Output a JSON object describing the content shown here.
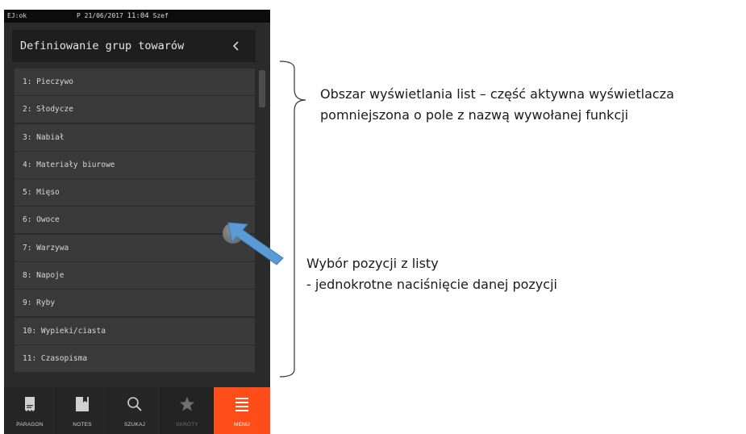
{
  "status_bar": {
    "left": "EJ:ok",
    "p_date": "P 21/06/2017",
    "time": "11:04",
    "user": "Szef"
  },
  "title": "Definiowanie grup towarów",
  "list_items": [
    "1: Pieczywo",
    "2: Słodycze",
    "3: Nabiał",
    "4: Materiały biurowe",
    "5: Mięso",
    "6: Owoce",
    "7: Warzywa",
    "8: Napoje",
    "9: Ryby",
    "10: Wypieki/ciasta",
    "11: Czasopisma"
  ],
  "bottom_nav": [
    {
      "label": "PARAGON",
      "icon": "receipt-icon"
    },
    {
      "label": "NOTES",
      "icon": "notes-icon"
    },
    {
      "label": "SZUKAJ",
      "icon": "search-icon"
    },
    {
      "label": "SKRÓTY",
      "icon": "star-icon"
    },
    {
      "label": "MENU",
      "icon": "menu-icon"
    }
  ],
  "annotations": {
    "list_area_line1": "Obszar wyświetlania list – część aktywna wyświetlacza",
    "list_area_line2": "pomniejszona o pole z nazwą wywołanej funkcji",
    "selection_line1": "Wybór pozycji z listy",
    "selection_line2": "- jednokrotne naciśnięcie danej pozycji"
  },
  "colors": {
    "menu_active": "#ff4d1a",
    "arrow": "#5b9bd5"
  }
}
